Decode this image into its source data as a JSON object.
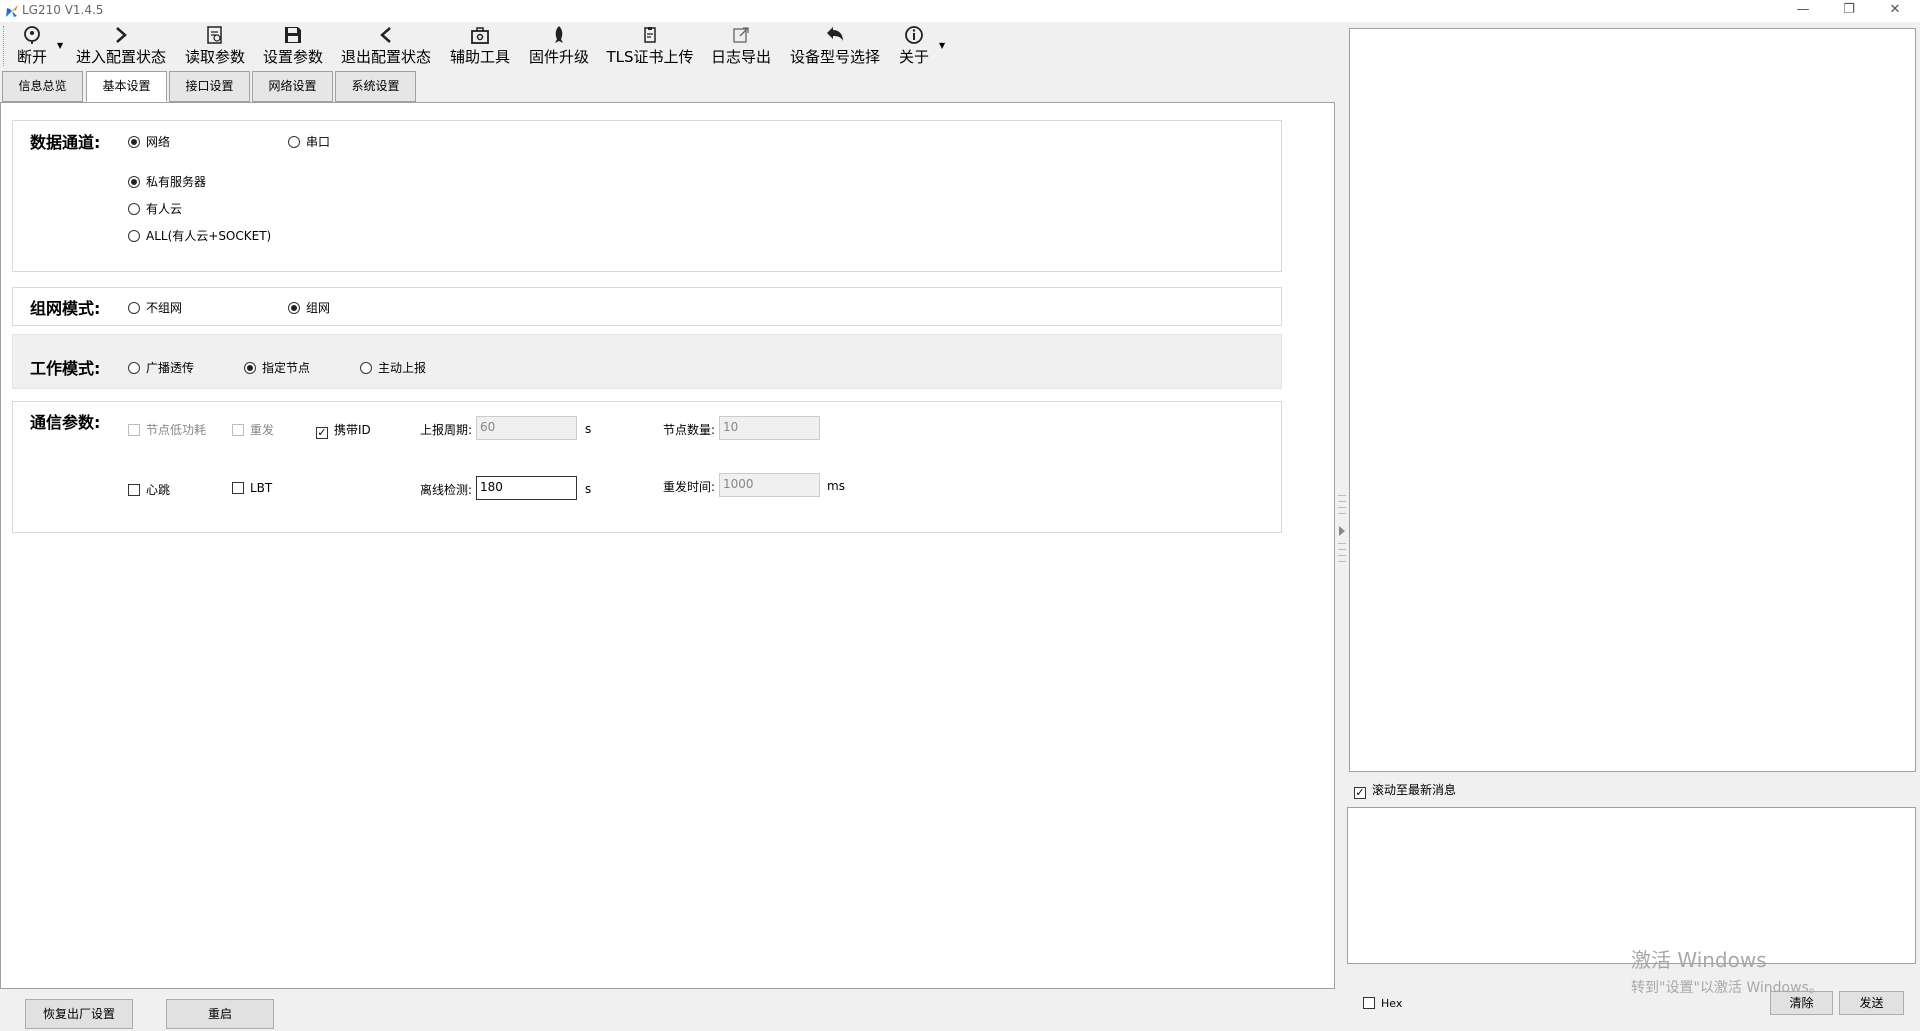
{
  "window": {
    "title": "LG210 V1.4.5",
    "controls": {
      "minimize": "—",
      "restore": "❐",
      "close": "✕"
    }
  },
  "toolbar": {
    "items": [
      {
        "label": "断开",
        "icon": "location-pin-icon"
      },
      {
        "label": "进入配置状态",
        "icon": "chevron-right-icon"
      },
      {
        "label": "读取参数",
        "icon": "read-document-icon"
      },
      {
        "label": "设置参数",
        "icon": "save-icon"
      },
      {
        "label": "退出配置状态",
        "icon": "chevron-left-icon"
      },
      {
        "label": "辅助工具",
        "icon": "toolbox-icon"
      },
      {
        "label": "固件升级",
        "icon": "rocket-icon"
      },
      {
        "label": "TLS证书上传",
        "icon": "certificate-icon"
      },
      {
        "label": "日志导出",
        "icon": "export-icon"
      },
      {
        "label": "设备型号选择",
        "icon": "undo-arrow-icon"
      },
      {
        "label": "关于",
        "icon": "info-icon"
      }
    ]
  },
  "tabs": [
    {
      "label": "信息总览",
      "active": false
    },
    {
      "label": "基本设置",
      "active": true
    },
    {
      "label": "接口设置",
      "active": false
    },
    {
      "label": "网络设置",
      "active": false
    },
    {
      "label": "系统设置",
      "active": false
    }
  ],
  "data_channel": {
    "title": "数据通道:",
    "options": [
      {
        "label": "网络",
        "selected": true
      },
      {
        "label": "串口",
        "selected": false
      }
    ],
    "server_options": [
      {
        "label": "私有服务器",
        "selected": true
      },
      {
        "label": "有人云",
        "selected": false
      },
      {
        "label": "ALL(有人云+SOCKET)",
        "selected": false
      }
    ]
  },
  "network_mode": {
    "title": "组网模式:",
    "options": [
      {
        "label": "不组网",
        "selected": false
      },
      {
        "label": "组网",
        "selected": true
      }
    ]
  },
  "work_mode": {
    "title": "工作模式:",
    "options": [
      {
        "label": "广播透传",
        "selected": false
      },
      {
        "label": "指定节点",
        "selected": true
      },
      {
        "label": "主动上报",
        "selected": false
      }
    ]
  },
  "comm_params": {
    "title": "通信参数:",
    "node_low_power": {
      "label": "节点低功耗",
      "checked": false,
      "enabled": false
    },
    "resend": {
      "label": "重发",
      "checked": false,
      "enabled": false
    },
    "carry_id": {
      "label": "携带ID",
      "checked": true,
      "enabled": true
    },
    "heartbeat": {
      "label": "心跳",
      "checked": false,
      "enabled": true
    },
    "lbt": {
      "label": "LBT",
      "checked": false,
      "enabled": true
    },
    "report_period": {
      "label": "上报周期:",
      "value": "60",
      "unit": "s"
    },
    "node_count": {
      "label": "节点数量:",
      "value": "10"
    },
    "offline_detect": {
      "label": "离线检测:",
      "value": "180",
      "unit": "s"
    },
    "resend_time": {
      "label": "重发时间:",
      "value": "1000",
      "unit": "ms"
    }
  },
  "bottom_buttons": {
    "factory_reset": "恢复出厂设置",
    "restart": "重启"
  },
  "right_panel": {
    "auto_scroll": {
      "label": "滚动至最新消息",
      "checked": true
    },
    "hex": {
      "label": "Hex",
      "checked": false
    },
    "clear_button": "清除",
    "send_button": "发送"
  },
  "watermark": {
    "line1": "激活 Windows",
    "line2": "转到\"设置\"以激活 Windows。"
  }
}
